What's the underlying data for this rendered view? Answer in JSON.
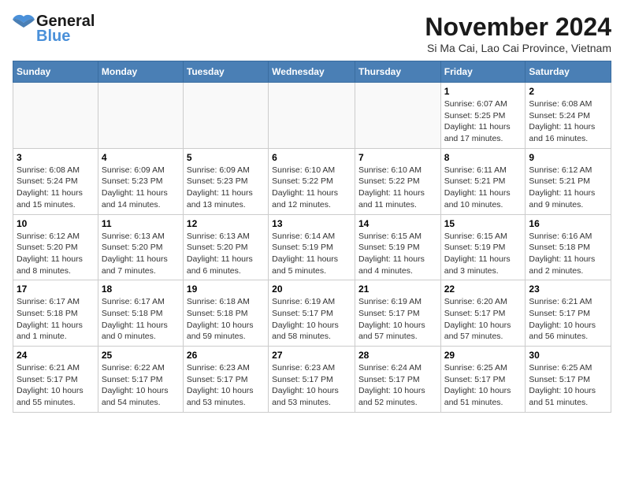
{
  "logo": {
    "text_general": "General",
    "text_blue": "Blue"
  },
  "title": {
    "month_year": "November 2024",
    "location": "Si Ma Cai, Lao Cai Province, Vietnam"
  },
  "weekdays": [
    "Sunday",
    "Monday",
    "Tuesday",
    "Wednesday",
    "Thursday",
    "Friday",
    "Saturday"
  ],
  "weeks": [
    [
      {
        "day": "",
        "detail": ""
      },
      {
        "day": "",
        "detail": ""
      },
      {
        "day": "",
        "detail": ""
      },
      {
        "day": "",
        "detail": ""
      },
      {
        "day": "",
        "detail": ""
      },
      {
        "day": "1",
        "detail": "Sunrise: 6:07 AM\nSunset: 5:25 PM\nDaylight: 11 hours and 17 minutes."
      },
      {
        "day": "2",
        "detail": "Sunrise: 6:08 AM\nSunset: 5:24 PM\nDaylight: 11 hours and 16 minutes."
      }
    ],
    [
      {
        "day": "3",
        "detail": "Sunrise: 6:08 AM\nSunset: 5:24 PM\nDaylight: 11 hours and 15 minutes."
      },
      {
        "day": "4",
        "detail": "Sunrise: 6:09 AM\nSunset: 5:23 PM\nDaylight: 11 hours and 14 minutes."
      },
      {
        "day": "5",
        "detail": "Sunrise: 6:09 AM\nSunset: 5:23 PM\nDaylight: 11 hours and 13 minutes."
      },
      {
        "day": "6",
        "detail": "Sunrise: 6:10 AM\nSunset: 5:22 PM\nDaylight: 11 hours and 12 minutes."
      },
      {
        "day": "7",
        "detail": "Sunrise: 6:10 AM\nSunset: 5:22 PM\nDaylight: 11 hours and 11 minutes."
      },
      {
        "day": "8",
        "detail": "Sunrise: 6:11 AM\nSunset: 5:21 PM\nDaylight: 11 hours and 10 minutes."
      },
      {
        "day": "9",
        "detail": "Sunrise: 6:12 AM\nSunset: 5:21 PM\nDaylight: 11 hours and 9 minutes."
      }
    ],
    [
      {
        "day": "10",
        "detail": "Sunrise: 6:12 AM\nSunset: 5:20 PM\nDaylight: 11 hours and 8 minutes."
      },
      {
        "day": "11",
        "detail": "Sunrise: 6:13 AM\nSunset: 5:20 PM\nDaylight: 11 hours and 7 minutes."
      },
      {
        "day": "12",
        "detail": "Sunrise: 6:13 AM\nSunset: 5:20 PM\nDaylight: 11 hours and 6 minutes."
      },
      {
        "day": "13",
        "detail": "Sunrise: 6:14 AM\nSunset: 5:19 PM\nDaylight: 11 hours and 5 minutes."
      },
      {
        "day": "14",
        "detail": "Sunrise: 6:15 AM\nSunset: 5:19 PM\nDaylight: 11 hours and 4 minutes."
      },
      {
        "day": "15",
        "detail": "Sunrise: 6:15 AM\nSunset: 5:19 PM\nDaylight: 11 hours and 3 minutes."
      },
      {
        "day": "16",
        "detail": "Sunrise: 6:16 AM\nSunset: 5:18 PM\nDaylight: 11 hours and 2 minutes."
      }
    ],
    [
      {
        "day": "17",
        "detail": "Sunrise: 6:17 AM\nSunset: 5:18 PM\nDaylight: 11 hours and 1 minute."
      },
      {
        "day": "18",
        "detail": "Sunrise: 6:17 AM\nSunset: 5:18 PM\nDaylight: 11 hours and 0 minutes."
      },
      {
        "day": "19",
        "detail": "Sunrise: 6:18 AM\nSunset: 5:18 PM\nDaylight: 10 hours and 59 minutes."
      },
      {
        "day": "20",
        "detail": "Sunrise: 6:19 AM\nSunset: 5:17 PM\nDaylight: 10 hours and 58 minutes."
      },
      {
        "day": "21",
        "detail": "Sunrise: 6:19 AM\nSunset: 5:17 PM\nDaylight: 10 hours and 57 minutes."
      },
      {
        "day": "22",
        "detail": "Sunrise: 6:20 AM\nSunset: 5:17 PM\nDaylight: 10 hours and 57 minutes."
      },
      {
        "day": "23",
        "detail": "Sunrise: 6:21 AM\nSunset: 5:17 PM\nDaylight: 10 hours and 56 minutes."
      }
    ],
    [
      {
        "day": "24",
        "detail": "Sunrise: 6:21 AM\nSunset: 5:17 PM\nDaylight: 10 hours and 55 minutes."
      },
      {
        "day": "25",
        "detail": "Sunrise: 6:22 AM\nSunset: 5:17 PM\nDaylight: 10 hours and 54 minutes."
      },
      {
        "day": "26",
        "detail": "Sunrise: 6:23 AM\nSunset: 5:17 PM\nDaylight: 10 hours and 53 minutes."
      },
      {
        "day": "27",
        "detail": "Sunrise: 6:23 AM\nSunset: 5:17 PM\nDaylight: 10 hours and 53 minutes."
      },
      {
        "day": "28",
        "detail": "Sunrise: 6:24 AM\nSunset: 5:17 PM\nDaylight: 10 hours and 52 minutes."
      },
      {
        "day": "29",
        "detail": "Sunrise: 6:25 AM\nSunset: 5:17 PM\nDaylight: 10 hours and 51 minutes."
      },
      {
        "day": "30",
        "detail": "Sunrise: 6:25 AM\nSunset: 5:17 PM\nDaylight: 10 hours and 51 minutes."
      }
    ]
  ]
}
